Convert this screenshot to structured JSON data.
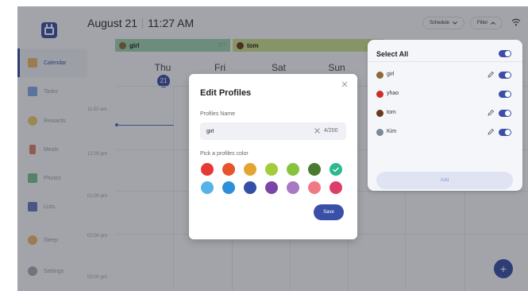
{
  "app": {
    "date": "August 21",
    "time": "11:27 AM",
    "schedule_label": "Schedule",
    "filter_label": "Filter"
  },
  "sidebar": {
    "items": [
      {
        "label": "Calendar",
        "color": "#e8a23c"
      },
      {
        "label": "Tasks",
        "color": "#5b8be0"
      },
      {
        "label": "Rewards",
        "color": "#e8b93c"
      },
      {
        "label": "Meals",
        "color": "#d0573c"
      },
      {
        "label": "Photos",
        "color": "#4caf6a"
      },
      {
        "label": "Lists",
        "color": "#3a4fa6"
      },
      {
        "label": "Sleep",
        "color": "#e8a23c"
      },
      {
        "label": "Settings",
        "color": "#8a8f9c"
      }
    ]
  },
  "profiles_strip": [
    {
      "name": "girl",
      "count": "2/7",
      "color": "#9ed0b0"
    },
    {
      "name": "tom",
      "count": "0",
      "color": "#c9dc8f"
    }
  ],
  "calendar": {
    "days": [
      "Thu",
      "Fri",
      "Sat",
      "Sun"
    ],
    "today_number": "21",
    "time_slots": [
      "11:00 am",
      "12:00 pm",
      "01:00 pm",
      "02:00 pm",
      "03:00 pm"
    ]
  },
  "select_panel": {
    "title": "Select All",
    "profiles": [
      {
        "name": "girl",
        "avatar_color": "#8a6a3c"
      },
      {
        "name": "yhao",
        "avatar_color": "#d22a2a"
      },
      {
        "name": "tom",
        "avatar_color": "#6a3a1c"
      },
      {
        "name": "Kim",
        "avatar_color": "#7a8a9a"
      }
    ],
    "add_label": "Add"
  },
  "dialog": {
    "title": "Edit Profiles",
    "name_label": "Profiles Name",
    "name_value": "girl",
    "counter": "4/200",
    "color_label": "Pick a profiles color",
    "colors_row1": [
      "#e53935",
      "#e6542b",
      "#e5a432",
      "#a3cc3c",
      "#86c440",
      "#4a7a30",
      "#2cb98e"
    ],
    "colors_row2": [
      "#54b3e8",
      "#2c8fd9",
      "#3350a6",
      "#7b45a8",
      "#a779c4",
      "#ef7a84",
      "#dd3d6a"
    ],
    "selected_color_index": 6,
    "save_label": "Save"
  }
}
